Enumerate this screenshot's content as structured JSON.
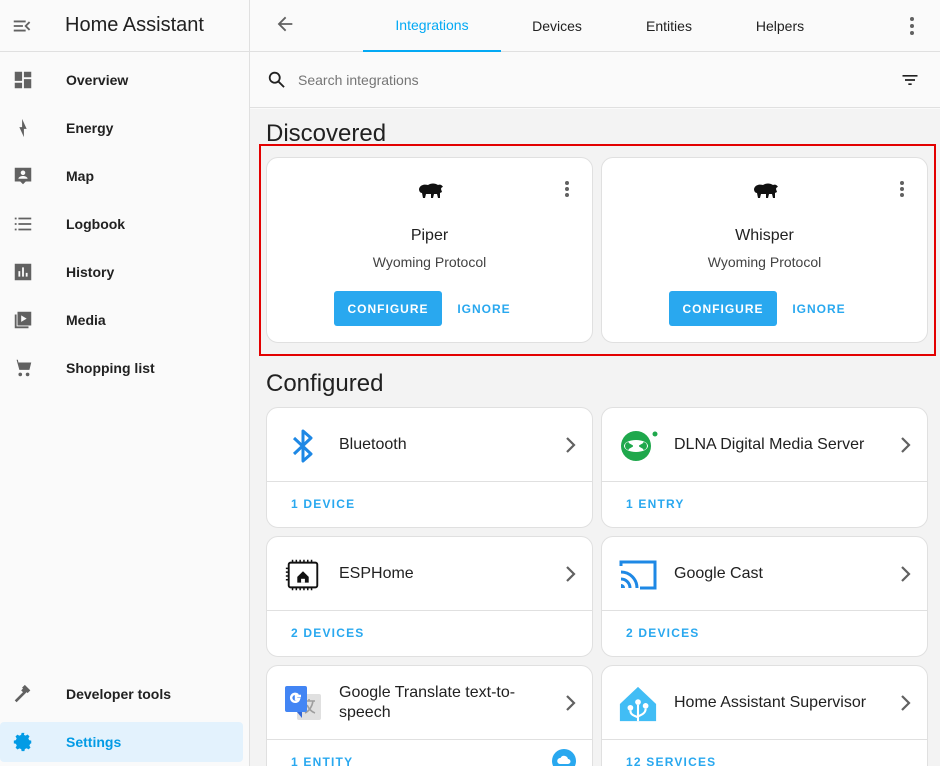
{
  "sidebar": {
    "title": "Home Assistant",
    "items": [
      {
        "label": "Overview",
        "icon": "dashboard-icon"
      },
      {
        "label": "Energy",
        "icon": "lightning-icon"
      },
      {
        "label": "Map",
        "icon": "map-person-icon"
      },
      {
        "label": "Logbook",
        "icon": "list-icon"
      },
      {
        "label": "History",
        "icon": "bar-chart-icon"
      },
      {
        "label": "Media",
        "icon": "play-box-icon"
      },
      {
        "label": "Shopping list",
        "icon": "cart-icon"
      }
    ],
    "bottom_items": [
      {
        "label": "Developer tools",
        "icon": "hammer-icon"
      },
      {
        "label": "Settings",
        "icon": "gear-icon",
        "active": true
      }
    ]
  },
  "topbar": {
    "tabs": [
      "Integrations",
      "Devices",
      "Entities",
      "Helpers"
    ],
    "active_tab": "Integrations"
  },
  "search": {
    "placeholder": "Search integrations"
  },
  "discovered": {
    "title": "Discovered",
    "cards": [
      {
        "name": "Piper",
        "protocol": "Wyoming Protocol",
        "configure": "CONFIGURE",
        "ignore": "IGNORE"
      },
      {
        "name": "Whisper",
        "protocol": "Wyoming Protocol",
        "configure": "CONFIGURE",
        "ignore": "IGNORE"
      }
    ]
  },
  "configured": {
    "title": "Configured",
    "cards": [
      {
        "name": "Bluetooth",
        "footer": "1 DEVICE",
        "icon": "bluetooth-icon"
      },
      {
        "name": "DLNA Digital Media Server",
        "footer": "1 ENTRY",
        "icon": "dlna-icon"
      },
      {
        "name": "ESPHome",
        "footer": "2 DEVICES",
        "icon": "esphome-icon"
      },
      {
        "name": "Google Cast",
        "footer": "2 DEVICES",
        "icon": "cast-icon"
      },
      {
        "name": "Google Translate text-to-speech",
        "footer": "1 ENTITY",
        "icon": "google-translate-icon"
      },
      {
        "name": "Home Assistant Supervisor",
        "footer": "12 SERVICES",
        "icon": "home-assistant-icon"
      }
    ]
  },
  "colors": {
    "accent": "#03a9f4",
    "highlight": "#e30000"
  }
}
